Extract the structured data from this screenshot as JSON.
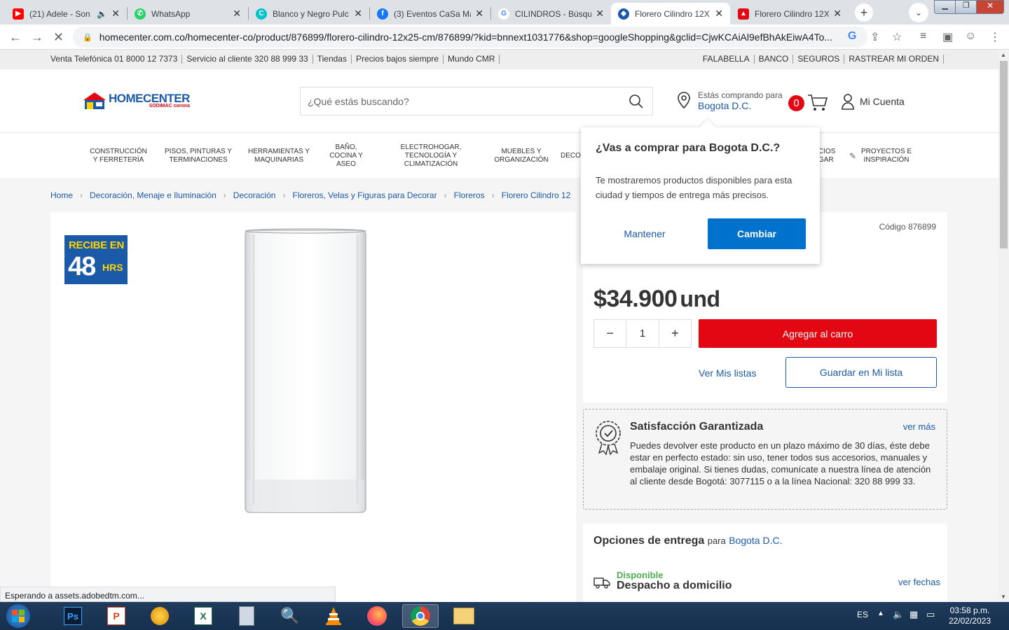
{
  "browser": {
    "tabs": [
      {
        "title": "(21) Adele - Son",
        "icon": "youtube-icon",
        "color": "#ff0000"
      },
      {
        "title": "WhatsApp",
        "icon": "whatsapp-icon",
        "color": "#25d366"
      },
      {
        "title": "Blanco y Negro Pulc",
        "icon": "canva-icon",
        "color": "#00c4cc"
      },
      {
        "title": "(3) Eventos CaSa Ma",
        "icon": "facebook-icon",
        "color": "#1877f2"
      },
      {
        "title": "CILINDROS - Búsque",
        "icon": "google-icon",
        "color": "#4285f4"
      },
      {
        "title": "Florero Cilindro 12X",
        "icon": "homecenter-icon",
        "color": "#e30613"
      },
      {
        "title": "Florero Cilindro 12X",
        "icon": "homecenter-icon",
        "color": "#e30613"
      }
    ],
    "url": "homecenter.com.co/homecenter-co/product/876899/florero-cilindro-12x25-cm/876899/?kid=bnnext1031776&shop=googleShopping&gclid=CjwKCAiAl9efBhAkEiwA4To...",
    "status": "Esperando a assets.adobedtm.com..."
  },
  "infobar": {
    "left": [
      "Venta Telefónica 01 8000 12 7373",
      "Servicio al cliente 320 88 999 33",
      "Tiendas",
      "Precios bajos siempre",
      "Mundo CMR"
    ],
    "right": [
      "FALABELLA",
      "BANCO",
      "SEGUROS",
      "RASTREAR MI ORDEN"
    ]
  },
  "header": {
    "logo_name": "HOMECENTER",
    "logo_sub": "SODIMAC corona",
    "search_placeholder": "¿Qué estás buscando?",
    "loc_line1": "Estás comprando para",
    "loc_city": "Bogota D.C.",
    "cart_count": "0",
    "account": "Mi Cuenta"
  },
  "categories": [
    "CONSTRUCCIÓN Y FERRETERÍA",
    "PISOS, PINTURAS Y TERMINACIONES",
    "HERRAMIENTAS Y MAQUINARIAS",
    "BAÑO, COCINA Y ASEO",
    "ELECTROHOGAR, TECNOLOGÍA Y CLIMATIZACIÓN",
    "MUEBLES Y ORGANIZACIÓN",
    "DECO",
    "CIOS GAR",
    "PROYECTOS E INSPIRACIÓN"
  ],
  "breadcrumb": [
    "Home",
    "Decoración, Menaje e Iluminación",
    "Decoración",
    "Floreros, Velas y Figuras para Decorar",
    "Floreros",
    "Florero Cilindro 12"
  ],
  "product": {
    "badge_line1": "RECIBE EN",
    "badge_number": "48",
    "badge_unit": "HRS",
    "code": "Código 876899",
    "price": "$34.900",
    "unit": "und",
    "qty": "1",
    "add_to_cart": "Agregar al carro",
    "view_lists": "Ver Mis listas",
    "save_list": "Guardar en Mi lista"
  },
  "satisfaction": {
    "title": "Satisfacción Garantizada",
    "more": "ver más",
    "body": "Puedes devolver este producto en un plazo máximo de 30 días, éste debe estar en perfecto estado: sin uso, tener todos sus accesorios, manuales y embalaje original. Si tienes dudas, comunícate a nuestra línea de atención al cliente desde Bogotá: 3077115 o a la línea Nacional: 320 88 999 33."
  },
  "delivery": {
    "title": "Opciones de entrega",
    "para": "para",
    "city": "Bogota D.C.",
    "available": "Disponible",
    "method": "Despacho a domicilio",
    "dates": "ver fechas"
  },
  "popup": {
    "title": "¿Vas a comprar para Bogota D.C.?",
    "body": "Te mostraremos productos disponibles para esta ciudad y tiempos de entrega más precisos.",
    "keep": "Mantener",
    "change": "Cambiar"
  },
  "taskbar": {
    "lang": "ES",
    "time": "03:58 p.m.",
    "date": "22/02/2023"
  }
}
